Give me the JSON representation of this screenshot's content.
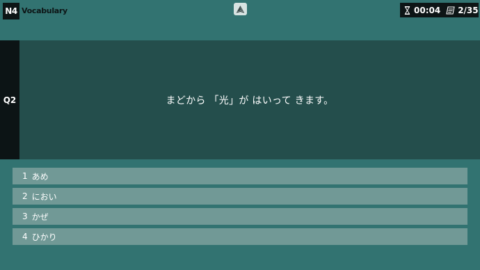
{
  "header": {
    "level": "N4",
    "section": "Vocabulary",
    "timer": "00:04",
    "progress": "2/35"
  },
  "question": {
    "label": "Q2",
    "text": "まどから 「光」が はいって きます。"
  },
  "answers": [
    {
      "num": "1",
      "text": "あめ"
    },
    {
      "num": "2",
      "text": "におい"
    },
    {
      "num": "3",
      "text": "かぜ"
    },
    {
      "num": "4",
      "text": "ひかり"
    }
  ],
  "colors": {
    "background": "#327371",
    "question_band": "#244e4c",
    "label_dark": "#0c1415",
    "answer_bg": "#719996"
  },
  "icons": {
    "center": "book-icon",
    "timer": "hourglass-icon",
    "progress": "notepad-icon"
  }
}
